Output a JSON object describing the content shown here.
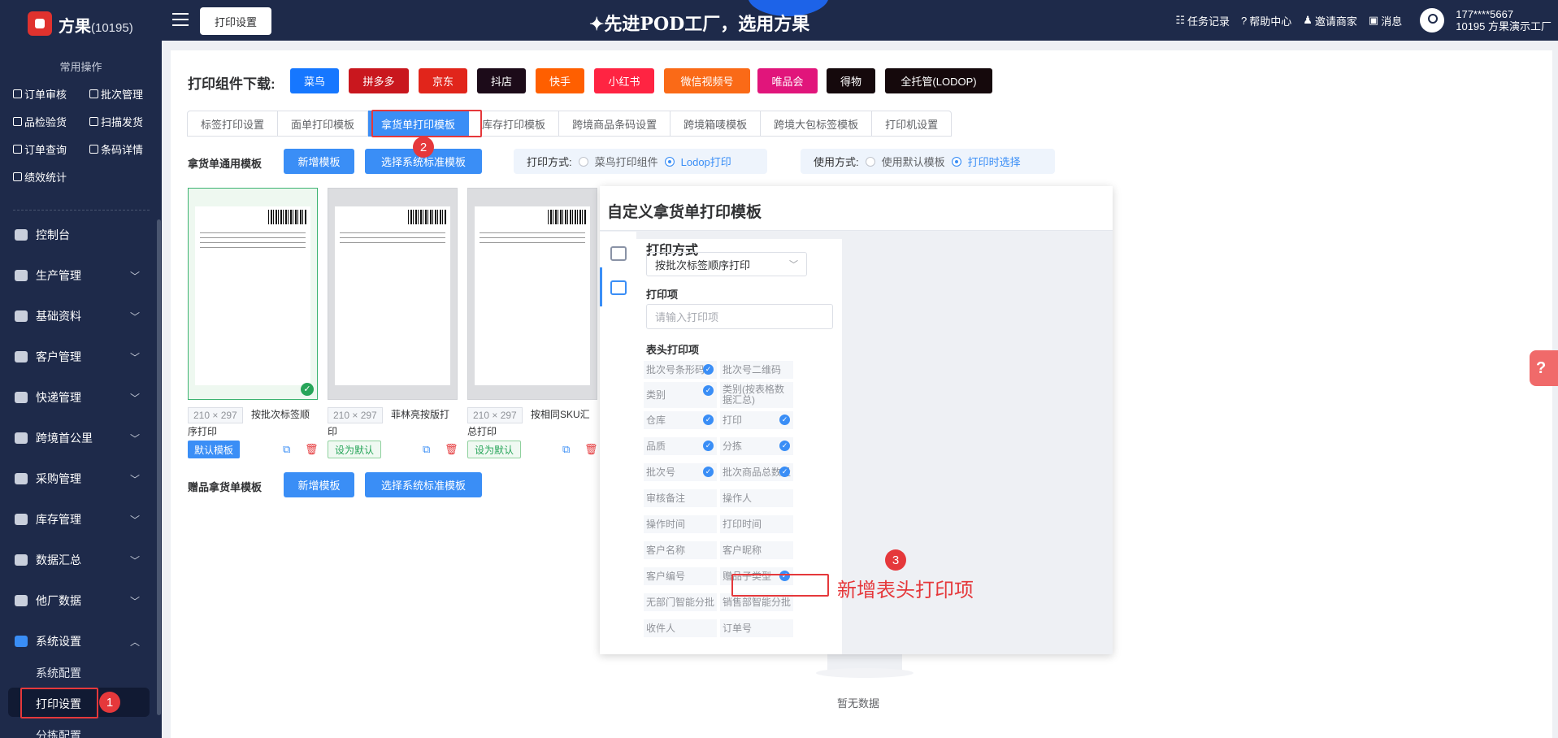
{
  "header": {
    "brand": "方果",
    "brand_id": "(10195)",
    "active_tab": "打印设置",
    "slogan": "✦先进POD工厂，选用方果",
    "links": [
      "任务记录",
      "帮助中心",
      "邀请商家",
      "消息"
    ],
    "user_phone": "177****5667",
    "user_shop": "10195 方果演示工厂"
  },
  "sidebar": {
    "common_title": "常用操作",
    "quick": [
      "订单审核",
      "批次管理",
      "品检验货",
      "扫描发货",
      "订单查询",
      "条码详情",
      "绩效统计"
    ],
    "nav": [
      "控制台",
      "生产管理",
      "基础资料",
      "客户管理",
      "快递管理",
      "跨境首公里",
      "采购管理",
      "库存管理",
      "数据汇总",
      "他厂数据",
      "系统设置"
    ],
    "sub": [
      "系统配置",
      "打印设置",
      "分拣配置"
    ]
  },
  "download": {
    "label": "打印组件下载:",
    "buttons": [
      {
        "label": "菜鸟",
        "color": "#1677ff"
      },
      {
        "label": "拼多多",
        "color": "#c9171e"
      },
      {
        "label": "京东",
        "color": "#e1251b"
      },
      {
        "label": "抖店",
        "color": "#1c0b19"
      },
      {
        "label": "快手",
        "color": "#ff5f00"
      },
      {
        "label": "小红书",
        "color": "#ff2442"
      },
      {
        "label": "微信视频号",
        "color": "#fa6a17"
      },
      {
        "label": "唯品会",
        "color": "#e1157b"
      },
      {
        "label": "得物",
        "color": "#15090c"
      },
      {
        "label": "全托管(LODOP)",
        "color": "#15090c"
      }
    ]
  },
  "tabs": [
    "标签打印设置",
    "面单打印模板",
    "拿货单打印模板",
    "库存打印模板",
    "跨境商品条码设置",
    "跨境箱唛模板",
    "跨境大包标签模板",
    "打印机设置"
  ],
  "section1": {
    "label": "拿货单通用模板",
    "add_btn": "新增模板",
    "select_btn": "选择系统标准模板",
    "print_mode_label": "打印方式:",
    "print_modes": [
      "菜鸟打印组件",
      "Lodop打印"
    ],
    "use_mode_label": "使用方式:",
    "use_modes": [
      "使用默认模板",
      "打印时选择"
    ]
  },
  "cards": [
    {
      "size": "210 × 297",
      "name": "按批次标签顺序打印",
      "tag": "默认模板"
    },
    {
      "size": "210 × 297",
      "name": "菲林亮按版打印",
      "tag": "设为默认"
    },
    {
      "size": "210 × 297",
      "name": "按相同SKU汇总打印",
      "tag": "设为默认"
    }
  ],
  "section2": {
    "label": "赠品拿货单模板",
    "add_btn": "新增模板",
    "select_btn": "选择系统标准模板"
  },
  "dialog": {
    "title": "自定义拿货单打印模板",
    "print_mode_label": "打印方式",
    "print_mode_value": "按批次标签顺序打印",
    "items_label": "打印项",
    "search_placeholder": "请输入打印项",
    "header_items_label": "表头打印项",
    "options": [
      {
        "label": "批次号条形码",
        "checked": true
      },
      {
        "label": "批次号二维码",
        "checked": false
      },
      {
        "label": "类别",
        "checked": true
      },
      {
        "label": "类别(按表格数据汇总)",
        "checked": false
      },
      {
        "label": "仓库",
        "checked": true
      },
      {
        "label": "打印",
        "checked": true
      },
      {
        "label": "品质",
        "checked": true
      },
      {
        "label": "分拣",
        "checked": true
      },
      {
        "label": "批次号",
        "checked": true
      },
      {
        "label": "批次商品总数量",
        "checked": true
      },
      {
        "label": "审核备注",
        "checked": false
      },
      {
        "label": "操作人",
        "checked": false
      },
      {
        "label": "操作时间",
        "checked": false
      },
      {
        "label": "打印时间",
        "checked": false
      },
      {
        "label": "客户名称",
        "checked": false
      },
      {
        "label": "客户昵称",
        "checked": false
      },
      {
        "label": "客户编号",
        "checked": false
      },
      {
        "label": "赠品子类型",
        "checked": true
      },
      {
        "label": "无部门智能分批",
        "checked": false
      },
      {
        "label": "销售部智能分批",
        "checked": false
      },
      {
        "label": "收件人",
        "checked": false
      },
      {
        "label": "订单号",
        "checked": false
      }
    ]
  },
  "annotations": {
    "badges": [
      "1",
      "2",
      "3"
    ],
    "note": "新增表头打印项"
  },
  "empty_text": "暂无数据",
  "help_icon": "?"
}
